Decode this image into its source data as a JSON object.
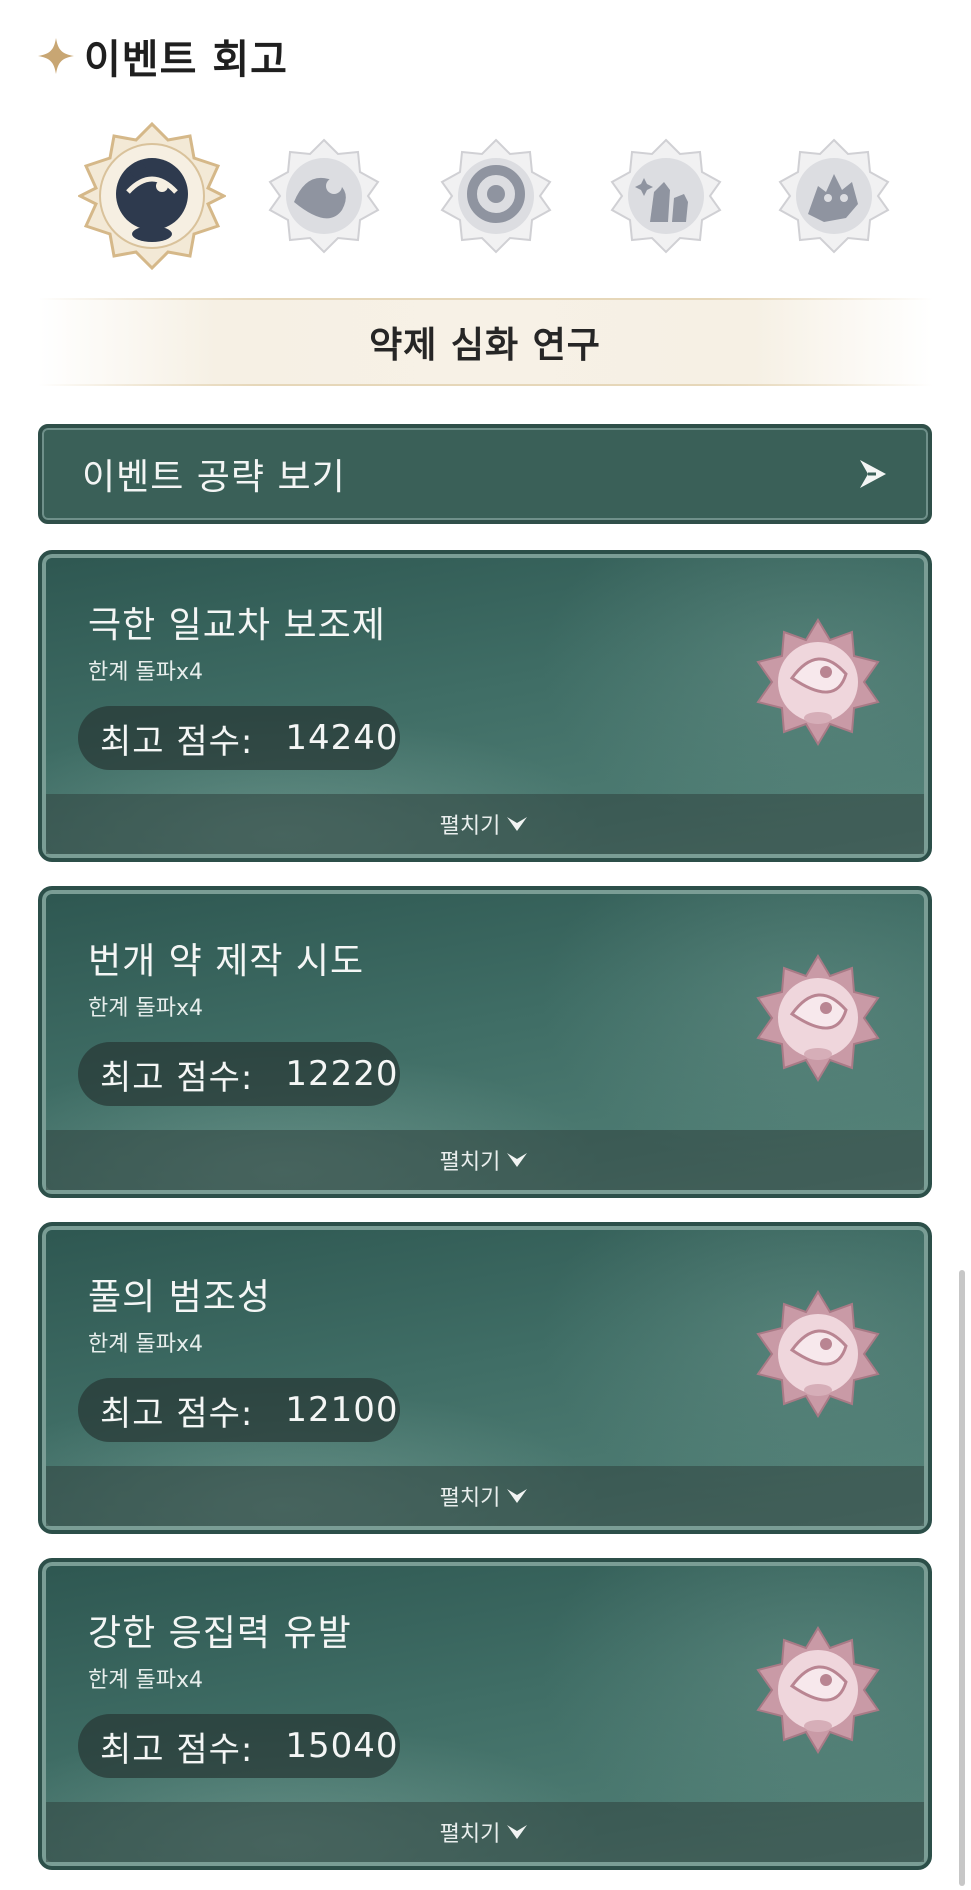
{
  "header": {
    "title": "이벤트 회고",
    "icon": "sparkle-star-icon"
  },
  "event_icons": [
    {
      "name": "event-icon-1",
      "selected": true
    },
    {
      "name": "event-icon-2",
      "selected": false
    },
    {
      "name": "event-icon-3",
      "selected": false
    },
    {
      "name": "event-icon-4",
      "selected": false
    },
    {
      "name": "event-icon-5",
      "selected": false
    }
  ],
  "banner": {
    "label": "약제 심화 연구"
  },
  "guide": {
    "label": "이벤트 공략 보기",
    "icon": "arrow-right-icon"
  },
  "cards": [
    {
      "name": "극한 일교차 보조제",
      "sub": "한계 돌파x4",
      "score_label": "최고 점수:",
      "score": "14240",
      "expand": "펼치기"
    },
    {
      "name": "번개 약 제작 시도",
      "sub": "한계 돌파x4",
      "score_label": "최고 점수:",
      "score": "12220",
      "expand": "펼치기"
    },
    {
      "name": "풀의 범조성",
      "sub": "한계 돌파x4",
      "score_label": "최고 점수:",
      "score": "12100",
      "expand": "펼치기"
    },
    {
      "name": "강한 응집력 유발",
      "sub": "한계 돌파x4",
      "score_label": "최고 점수:",
      "score": "15040",
      "expand": "펼치기"
    }
  ],
  "colors": {
    "accent_gold": "#d6b98a",
    "card_teal": "#3f6d65",
    "medal_pink": "#e8c6cf"
  }
}
